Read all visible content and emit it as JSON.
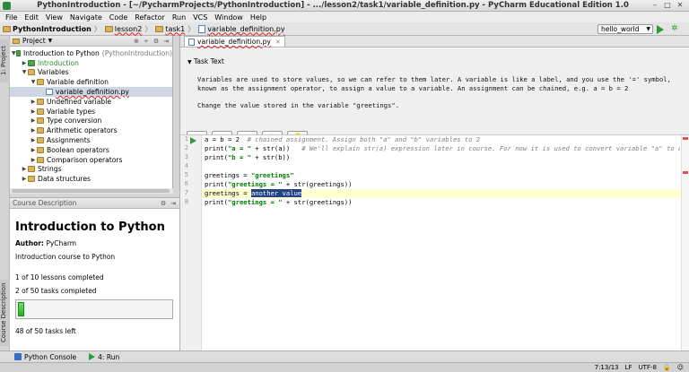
{
  "window": {
    "title": "PythonIntroduction - [~/PycharmProjects/PythonIntroduction] - .../lesson2/task1/variable_definition.py - PyCharm Educational Edition 1.0"
  },
  "menu": [
    "File",
    "Edit",
    "View",
    "Navigate",
    "Code",
    "Refactor",
    "Run",
    "VCS",
    "Window",
    "Help"
  ],
  "breadcrumbs": [
    "PythonIntroduction",
    "lesson2",
    "task1",
    "variable_definition.py"
  ],
  "run_config": "hello_world",
  "left_tabs": {
    "project": "1: Project",
    "course_description": "Course Description"
  },
  "project_panel": {
    "title": "Project",
    "tree": [
      {
        "label": "Introduction to Python",
        "extra": "(PythonIntroduction)"
      },
      {
        "label": "Introduction"
      },
      {
        "label": "Variables"
      },
      {
        "label": "Variable definition"
      },
      {
        "label": "variable_definition.py"
      },
      {
        "label": "Undefined variable"
      },
      {
        "label": "Variable types"
      },
      {
        "label": "Type conversion"
      },
      {
        "label": "Arithmetic operators"
      },
      {
        "label": "Assignments"
      },
      {
        "label": "Boolean operators"
      },
      {
        "label": "Comparison operators"
      },
      {
        "label": "Strings"
      },
      {
        "label": "Data structures"
      }
    ]
  },
  "course_description": {
    "header": "Course Description",
    "title": "Introduction to Python",
    "author_label": "Author:",
    "author": "PyCharm",
    "summary": "Introduction course to Python",
    "lessons_done": "1 of 10 lessons completed",
    "tasks_done": "2 of 50 tasks completed",
    "tasks_left": "48 of 50 tasks left",
    "progress_fraction": 0.04
  },
  "editor": {
    "tab_label": "variable_definition.py",
    "task_text_header": "Task Text",
    "task_paragraph_1": "Variables are used to store values, so we can refer to them later. A variable is like a label, and you use the '=' symbol, known as the assignment operator, to assign a value to a variable. An assignment can be chained, e.g. a = b = 2",
    "task_paragraph_2": "Change the value stored in the variable \"greetings\".",
    "line_numbers": [
      "1",
      "2",
      "3",
      "4",
      "5",
      "6",
      "7",
      "8"
    ]
  },
  "bottom_tools": {
    "console": "Python Console",
    "run": "4: Run"
  },
  "status": {
    "position": "7:13/13",
    "line_sep": "LF",
    "encoding": "UTF-8"
  },
  "colors": {
    "progress_fill": "#23b023",
    "selection": "#214283",
    "current_line": "#ffffd0"
  }
}
